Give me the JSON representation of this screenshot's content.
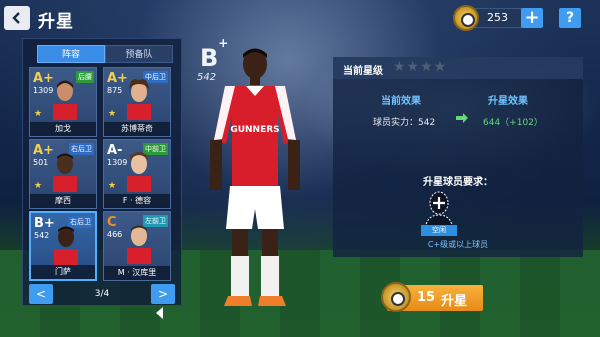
{
  "header": {
    "title": "升星",
    "currency_amount": "253",
    "plus_label": "+",
    "help_label": "?"
  },
  "left_panel": {
    "tabs": [
      {
        "label": "阵容",
        "active": true
      },
      {
        "label": "预备队",
        "active": false
      }
    ],
    "players": [
      {
        "grade": "A+",
        "rating": "1309",
        "position": "后腰",
        "position_color": "green",
        "name": "加戈",
        "stars": 1
      },
      {
        "grade": "A+",
        "rating": "875",
        "position": "中后卫",
        "position_color": "blue",
        "name": "苏博蒂奇",
        "stars": 1
      },
      {
        "grade": "A+",
        "rating": "501",
        "position": "右后卫",
        "position_color": "blue",
        "name": "摩西",
        "stars": 1
      },
      {
        "grade": "A-",
        "rating": "1309",
        "position": "中前卫",
        "position_color": "green",
        "name": "F · 德容",
        "stars": 1
      },
      {
        "grade": "B+",
        "rating": "542",
        "position": "右后卫",
        "position_color": "blue",
        "name": "门萨",
        "stars": 0,
        "selected": true
      },
      {
        "grade": "C",
        "rating": "466",
        "position": "左前卫",
        "position_color": "cyan",
        "name": "M · 汉库里",
        "stars": 0
      }
    ],
    "pager": {
      "prev": "<",
      "next": ">",
      "text": "3/4"
    }
  },
  "hero": {
    "grade": "B",
    "grade_suffix": "+",
    "rating": "542",
    "shirt_text": "GUNNERS"
  },
  "right_panel": {
    "star_level_label": "当前星级",
    "stars_display": "★★★★",
    "current_effect_label": "当前效果",
    "upgraded_effect_label": "升星效果",
    "current_stat": "球员实力：542",
    "upgraded_stat": "644（+102）",
    "requirement_title": "升星球员要求：",
    "slot_label": "空闲",
    "requirement_caption": "C+级或以上球员"
  },
  "upgrade_button": {
    "cost": "15",
    "label": "升星"
  },
  "colors": {
    "accent_blue": "#3f9cf0",
    "upgrade_orange": "#f0a030",
    "stat_green": "#64d977",
    "header_cyan": "#6ec4ff"
  }
}
